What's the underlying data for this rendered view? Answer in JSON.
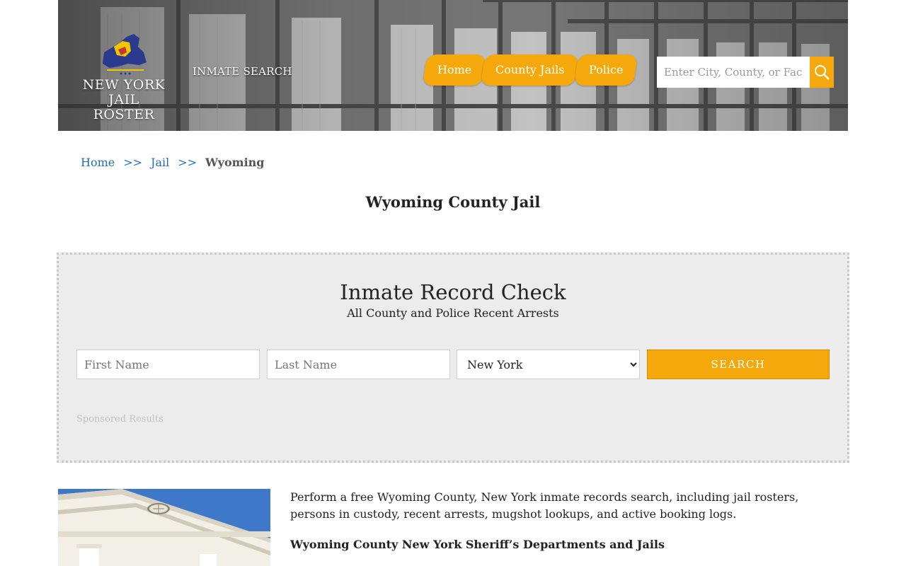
{
  "header": {
    "logo_line1": "NEW YORK",
    "logo_line2": "JAIL ROSTER",
    "inmate_search_label": "INMATE SEARCH",
    "nav": [
      {
        "label": "Home"
      },
      {
        "label": "County Jails"
      },
      {
        "label": "Police"
      }
    ],
    "search_placeholder": "Enter City, County, or Facility",
    "accent_color": "#f5a80c"
  },
  "breadcrumb": {
    "home": "Home",
    "jail": "Jail",
    "separator": ">>",
    "current": "Wyoming"
  },
  "page_title": "Wyoming County Jail",
  "record_check": {
    "title": "Inmate Record Check",
    "subtitle": "All County and Police Recent Arrests",
    "first_name_placeholder": "First Name",
    "last_name_placeholder": "Last Name",
    "state_selected": "New York",
    "search_label": "SEARCH",
    "sponsored_label": "Sponsored Results"
  },
  "content": {
    "intro": "Perform a free Wyoming County, New York inmate records search, including jail rosters, persons in custody, recent arrests, mugshot lookups, and active booking logs.",
    "section_heading": "Wyoming County New York Sheriff’s Departments and Jails"
  }
}
